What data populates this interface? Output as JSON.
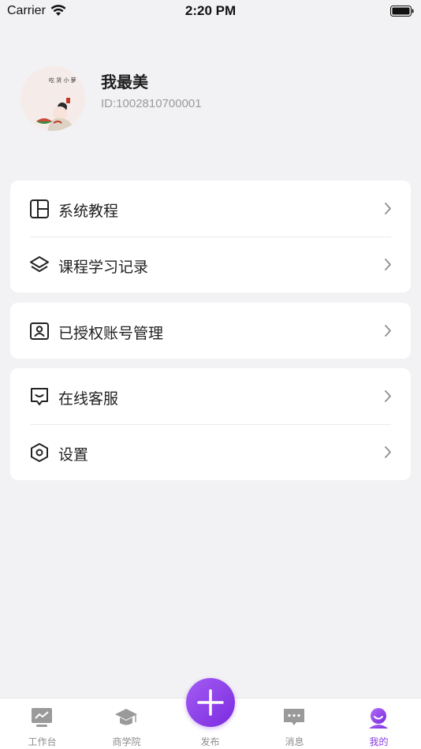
{
  "status_bar": {
    "carrier": "Carrier",
    "time": "2:20 PM"
  },
  "profile": {
    "nickname": "我最美",
    "user_id": "ID:1002810700001"
  },
  "menu_groups": [
    [
      {
        "label": "系统教程",
        "icon": "layout-icon"
      },
      {
        "label": "课程学习记录",
        "icon": "layers-icon"
      }
    ],
    [
      {
        "label": "已授权账号管理",
        "icon": "account-card-icon"
      }
    ],
    [
      {
        "label": "在线客服",
        "icon": "chat-support-icon"
      },
      {
        "label": "设置",
        "icon": "hexagon-settings-icon"
      }
    ]
  ],
  "tab_bar": {
    "tabs": [
      {
        "label": "工作台",
        "icon": "workbench-icon"
      },
      {
        "label": "商学院",
        "icon": "graduation-cap-icon"
      },
      {
        "label": "发布",
        "icon": "plus-icon"
      },
      {
        "label": "消息",
        "icon": "message-icon"
      },
      {
        "label": "我的",
        "icon": "profile-icon"
      }
    ],
    "active_index": 4
  },
  "colors": {
    "accent": "#8a3ce0",
    "background": "#f2f2f4",
    "inactive_tab": "#8d8d8d"
  }
}
